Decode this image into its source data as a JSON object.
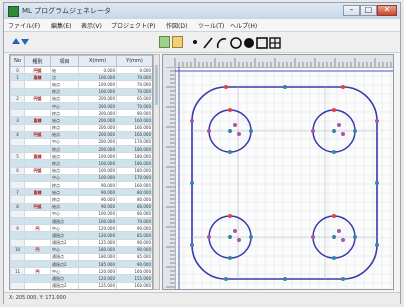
{
  "window": {
    "title": "ML プログラムジェネレータ",
    "minimize_glyph": "–",
    "maximize_glyph": "□",
    "close_glyph": "✕"
  },
  "menu": [
    {
      "label": "ファイル(F)"
    },
    {
      "label": "編集(E)"
    },
    {
      "label": "表示(V)"
    },
    {
      "label": "プロジェクト(P)"
    },
    {
      "label": "作図(D)"
    },
    {
      "label": "ツール(T)"
    },
    {
      "label": "ヘルプ(H)"
    }
  ],
  "toolbar": {
    "icons": [
      "up-arrow-icon",
      "down-arrow-icon",
      "select-tool-icon",
      "edit-tool-icon",
      "point-tool-icon",
      "line-tool-icon",
      "arc-tool-icon",
      "circle-tool-icon",
      "filled-circle-tool-icon",
      "rect-tool-icon",
      "grid-tool-icon"
    ]
  },
  "table": {
    "headers": [
      "No",
      "種別",
      "項目",
      "X(mm)",
      "Y(mm)"
    ],
    "rows": [
      {
        "no": "0",
        "type": "円弧",
        "item": "始",
        "x": "0.000",
        "y": "0.000",
        "sel": false
      },
      {
        "no": "1",
        "type": "直線",
        "item": "点",
        "x": "100.000",
        "y": "70.000",
        "sel": true
      },
      {
        "no": "",
        "type": "",
        "item": "始点",
        "x": "100.000",
        "y": "70.000",
        "sel": false
      },
      {
        "no": "",
        "type": "",
        "item": "終点",
        "x": "100.000",
        "y": "70.000",
        "sel": true
      },
      {
        "no": "2",
        "type": "円弧",
        "item": "始点",
        "x": "200.000",
        "y": "65.000",
        "sel": false
      },
      {
        "no": "",
        "type": "",
        "item": "中心",
        "x": "200.000",
        "y": "70.000",
        "sel": true
      },
      {
        "no": "",
        "type": "",
        "item": "終点",
        "x": "200.000",
        "y": "80.000",
        "sel": false
      },
      {
        "no": "3",
        "type": "直線",
        "item": "始点",
        "x": "200.000",
        "y": "160.000",
        "sel": true
      },
      {
        "no": "",
        "type": "",
        "item": "終点",
        "x": "200.000",
        "y": "160.000",
        "sel": false
      },
      {
        "no": "4",
        "type": "円弧",
        "item": "始点",
        "x": "200.000",
        "y": "160.000",
        "sel": true
      },
      {
        "no": "",
        "type": "",
        "item": "中心",
        "x": "200.000",
        "y": "170.000",
        "sel": false
      },
      {
        "no": "",
        "type": "",
        "item": "終点",
        "x": "200.000",
        "y": "180.000",
        "sel": true
      },
      {
        "no": "5",
        "type": "直線",
        "item": "始点",
        "x": "100.000",
        "y": "180.000",
        "sel": false
      },
      {
        "no": "",
        "type": "",
        "item": "終点",
        "x": "100.000",
        "y": "180.000",
        "sel": true
      },
      {
        "no": "6",
        "type": "円弧",
        "item": "始点",
        "x": "100.000",
        "y": "180.000",
        "sel": false
      },
      {
        "no": "",
        "type": "",
        "item": "中心",
        "x": "100.000",
        "y": "170.000",
        "sel": true
      },
      {
        "no": "",
        "type": "",
        "item": "終点",
        "x": "90.000",
        "y": "160.000",
        "sel": false
      },
      {
        "no": "7",
        "type": "直線",
        "item": "始点",
        "x": "90.000",
        "y": "80.000",
        "sel": true
      },
      {
        "no": "",
        "type": "",
        "item": "終点",
        "x": "90.000",
        "y": "80.000",
        "sel": false
      },
      {
        "no": "8",
        "type": "円弧",
        "item": "始点",
        "x": "90.000",
        "y": "80.000",
        "sel": true
      },
      {
        "no": "",
        "type": "",
        "item": "中心",
        "x": "100.000",
        "y": "80.000",
        "sel": false
      },
      {
        "no": "",
        "type": "",
        "item": "通過点",
        "x": "100.000",
        "y": "70.000",
        "sel": true
      },
      {
        "no": "9",
        "type": "円",
        "item": "中心",
        "x": "120.000",
        "y": "90.000",
        "sel": false
      },
      {
        "no": "",
        "type": "",
        "item": "通過点",
        "x": "120.000",
        "y": "85.000",
        "sel": true
      },
      {
        "no": "",
        "type": "",
        "item": "通過点2",
        "x": "125.000",
        "y": "90.000",
        "sel": false
      },
      {
        "no": "10",
        "type": "円",
        "item": "中心",
        "x": "180.000",
        "y": "90.000",
        "sel": true
      },
      {
        "no": "",
        "type": "",
        "item": "通過点",
        "x": "180.000",
        "y": "85.000",
        "sel": false
      },
      {
        "no": "",
        "type": "",
        "item": "通過点2",
        "x": "185.000",
        "y": "90.000",
        "sel": true
      },
      {
        "no": "11",
        "type": "円",
        "item": "中心",
        "x": "120.000",
        "y": "160.000",
        "sel": false
      },
      {
        "no": "",
        "type": "",
        "item": "通過点",
        "x": "120.000",
        "y": "155.000",
        "sel": true
      },
      {
        "no": "",
        "type": "",
        "item": "通過点2",
        "x": "125.000",
        "y": "160.000",
        "sel": false
      },
      {
        "no": "12",
        "type": "円",
        "item": "中心",
        "x": "180.000",
        "y": "160.000",
        "sel": true
      },
      {
        "no": "",
        "type": "",
        "item": "通過点",
        "x": "180.000",
        "y": "155.000",
        "sel": false
      },
      {
        "no": "",
        "type": "",
        "item": "通過点2",
        "x": "185.000",
        "y": "160.000",
        "sel": true
      }
    ]
  },
  "status": {
    "text": "X: 205.000,  Y: 171.000"
  },
  "colors": {
    "shape": "#3a3aa8",
    "point_red": "#d44",
    "point_blue": "#38a",
    "point_purple": "#a5a",
    "grid": "#dce3ea"
  }
}
